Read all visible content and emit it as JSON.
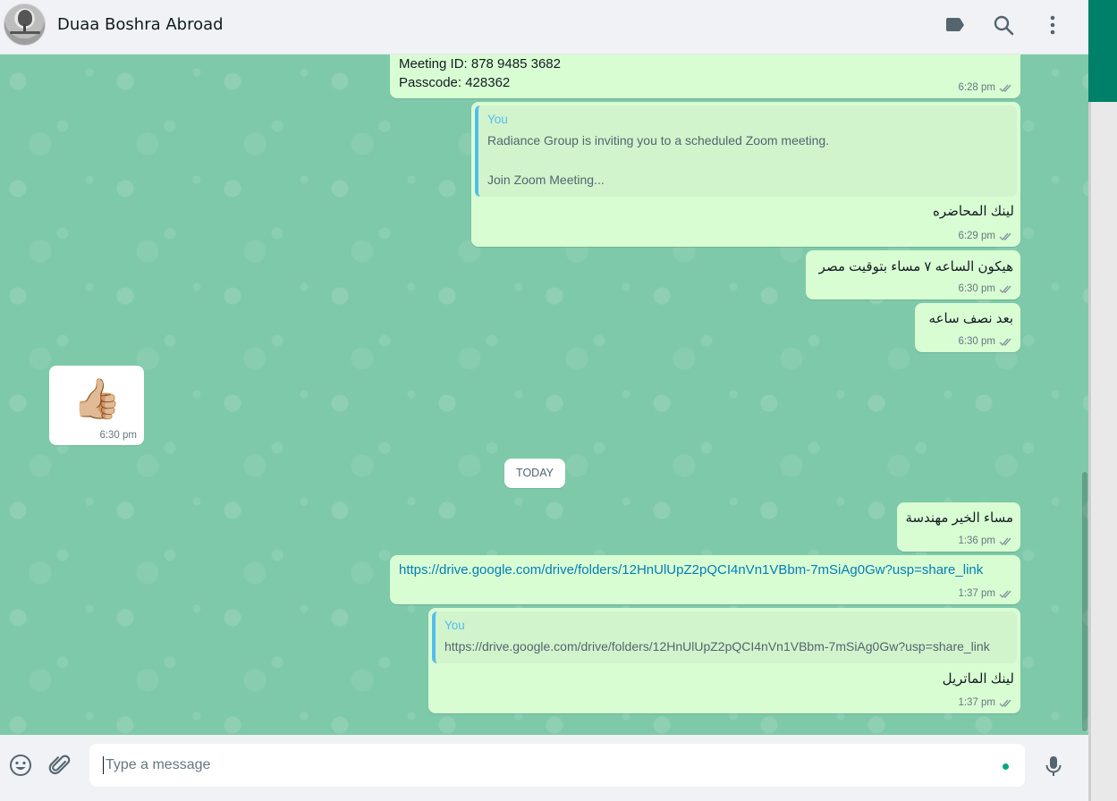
{
  "header": {
    "contact_name": "Duaa Boshra Abroad",
    "icons": [
      "label-icon",
      "search-icon",
      "menu-icon"
    ]
  },
  "colors": {
    "outgoing_bubble": "#d9fdd3",
    "incoming_bubble": "#ffffff",
    "chat_background": "#7ec9a9",
    "quote_accent": "#53bdeb",
    "brand": "#008069",
    "link": "#027eb5"
  },
  "messages": [
    {
      "type": "out",
      "lines": [
        "Meeting ID: 878 9485 3682",
        "Passcode: 428362"
      ],
      "time": "6:28 pm",
      "status": "delivered"
    },
    {
      "type": "out",
      "quote": {
        "author": "You",
        "line1": "Radiance Group is inviting you to a scheduled Zoom meeting.",
        "line2": "Join Zoom Meeting..."
      },
      "text": "لينك المحاضره",
      "time": "6:29 pm",
      "status": "delivered"
    },
    {
      "type": "out",
      "text": "هيكون الساعه ٧ مساء بتوقيت مصر",
      "time": "6:30 pm",
      "status": "delivered"
    },
    {
      "type": "out",
      "text": "بعد نصف ساعه",
      "time": "6:30 pm",
      "status": "delivered"
    },
    {
      "type": "in",
      "emoji": "👍🏼",
      "time": "6:30 pm"
    },
    {
      "type": "out",
      "text": "مساء الخير مهندسة",
      "time": "1:36 pm",
      "status": "delivered"
    },
    {
      "type": "out",
      "link": "https://drive.google.com/drive/folders/12HnUlUpZ2pQCI4nVn1VBbm-7mSiAg0Gw?usp=share_link",
      "time": "1:37 pm",
      "status": "delivered"
    },
    {
      "type": "out",
      "quote": {
        "author": "You",
        "line1": "https://drive.google.com/drive/folders/12HnUlUpZ2pQCI4nVn1VBbm-7mSiAg0Gw?usp=share_link"
      },
      "text": "لينك الماتريل",
      "time": "1:37 pm",
      "status": "delivered"
    }
  ],
  "day_divider": "TODAY",
  "footer": {
    "placeholder": "Type a message",
    "icons": [
      "emoji-icon",
      "attach-icon",
      "mic-icon"
    ]
  }
}
